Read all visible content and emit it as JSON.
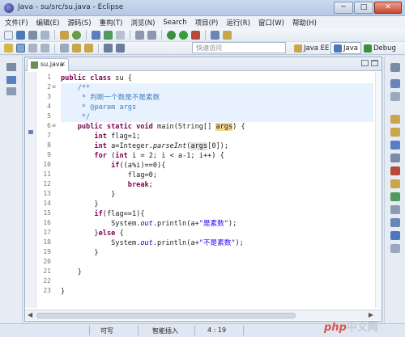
{
  "window": {
    "title": "Java - su/src/su.java - Eclipse",
    "buttons": [
      "─",
      "□",
      "✕"
    ]
  },
  "menu": [
    "文件(F)",
    "编辑(E)",
    "源码(S)",
    "重构(T)",
    "浏览(N)",
    "Search",
    "项目(P)",
    "运行(R)",
    "窗口(W)",
    "帮助(H)"
  ],
  "quick_access": {
    "placeholder": "快速访问"
  },
  "perspectives": [
    {
      "label": "Java EE",
      "active": false
    },
    {
      "label": "Java",
      "active": true
    },
    {
      "label": "Debug",
      "active": false
    }
  ],
  "editor": {
    "tab_label": "su.java",
    "line_numbers": [
      "1",
      "2",
      "3",
      "4",
      "5",
      "6",
      "7",
      "8",
      "9",
      "10",
      "11",
      "12",
      "13",
      "14",
      "15",
      "16",
      "17",
      "18",
      "19",
      "20",
      "21",
      "22",
      "23"
    ],
    "code_text": {
      "l1_kw": "public class",
      "l1_name": " su {",
      "l2": "/**",
      "l3": " * 判断一个数是不是素数",
      "l4_tag": " * @param",
      "l4_arg": " args",
      "l5": " */",
      "l6_kw": "public static void",
      "l6_a": " main(String[] ",
      "l6_arg": "args",
      "l6_b": ") {",
      "l7_kw": "int",
      "l7": " flag=1;",
      "l8_kw": "int",
      "l8_a": " a=Integer.",
      "l8_m": "parseInt",
      "l8_b": "(",
      "l8_arg": "args",
      "l8_c": "[0]);",
      "l9_kw": "for",
      "l9_a": " (",
      "l9_kw2": "int",
      "l9_b": " i = 2; i < a-1; i++) {",
      "l10_kw": "if",
      "l10": "((a%i)==0){",
      "l11": "flag=0;",
      "l12_kw": "break",
      "l12": ";",
      "l13": "}",
      "l14": "}",
      "l15_kw": "if",
      "l15": "(flag==1){",
      "l16_a": "System.",
      "l16_out": "out",
      "l16_b": ".println(a+",
      "l16_str": "\"是素数\"",
      "l16_c": ");",
      "l17_a": "}",
      "l17_kw": "else",
      "l17_b": " {",
      "l18_a": "System.",
      "l18_out": "out",
      "l18_b": ".println(a+",
      "l18_str": "\"不是素数\"",
      "l18_c": ");",
      "l19": "}",
      "l21": "}",
      "l23": "}"
    }
  },
  "status": {
    "writable": "可写",
    "insert_mode": "智能插入",
    "position": "4 : 19"
  },
  "watermark": {
    "php": "php",
    "site": "中文网"
  },
  "colors": {
    "keyword": "#7f0055",
    "javadoc": "#3f7fbf",
    "string": "#2a00ff",
    "field": "#0000c0",
    "occurrence": "#f0d88e"
  }
}
